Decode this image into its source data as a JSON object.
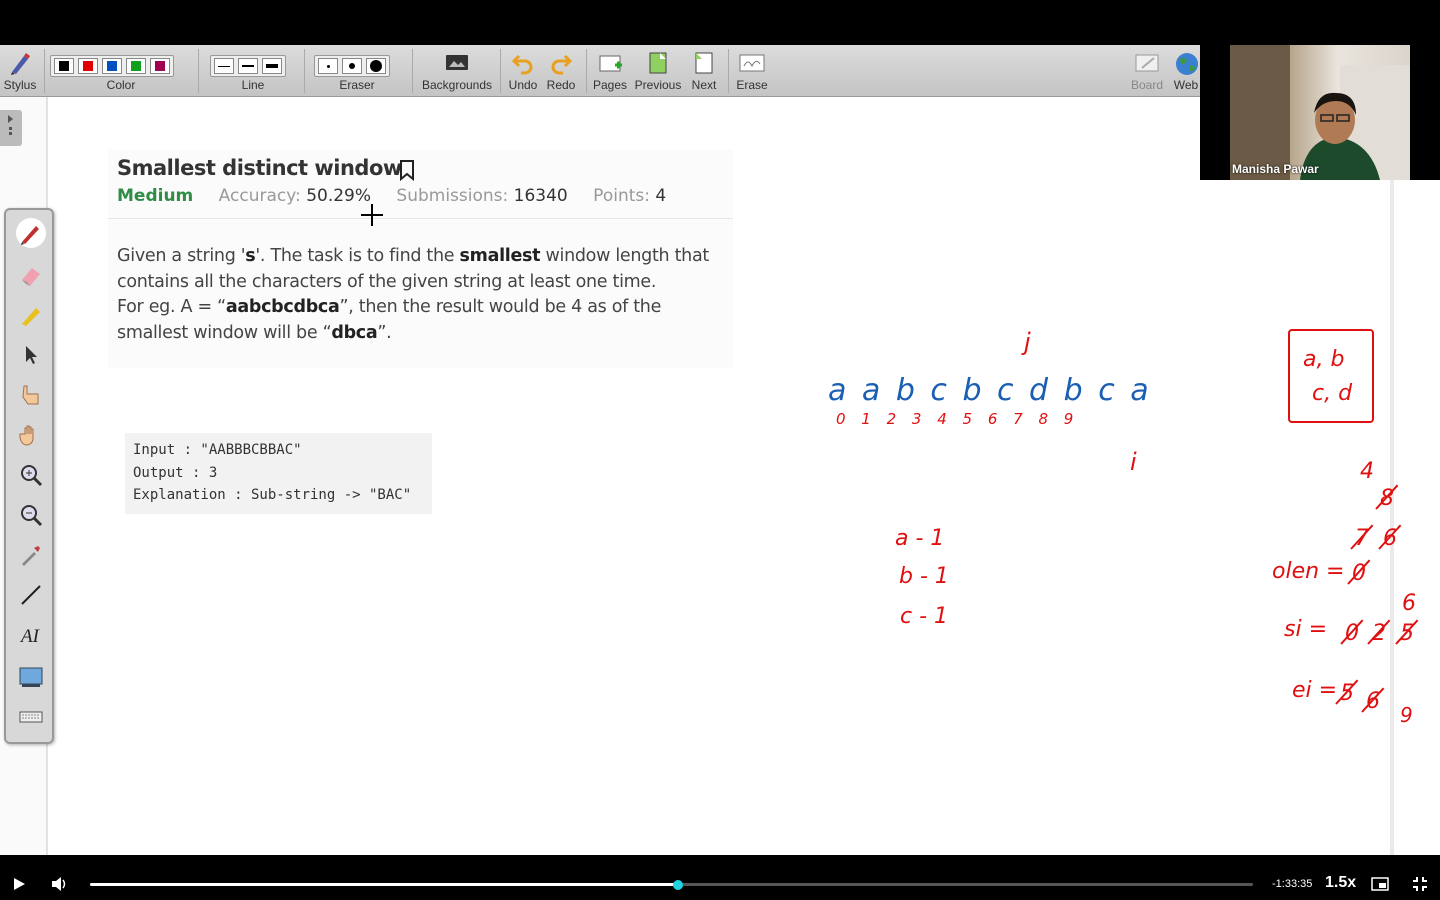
{
  "toolbar": {
    "stylus": "Stylus",
    "color": "Color",
    "line": "Line",
    "eraser": "Eraser",
    "backgrounds": "Backgrounds",
    "undo": "Undo",
    "redo": "Redo",
    "pages": "Pages",
    "previous": "Previous",
    "next": "Next",
    "erase": "Erase",
    "board": "Board",
    "web": "Web",
    "colors": [
      "#000000",
      "#e00000",
      "#0050c0",
      "#10a020",
      "#a00050"
    ]
  },
  "problem": {
    "title": "Smallest distinct window",
    "difficulty": "Medium",
    "accuracy_label": "Accuracy:",
    "accuracy_value": "50.29%",
    "submissions_label": "Submissions:",
    "submissions_value": "16340",
    "points_label": "Points:",
    "points_value": "4",
    "desc_1": "Given a string '",
    "desc_s": "s",
    "desc_2": "'. The task is to find the ",
    "desc_smallest": "smallest",
    "desc_3": " window length that contains all the characters of the given string at least one time.",
    "desc_4": "For eg. A = “",
    "desc_eg": "aabcbcdbca",
    "desc_5": "”, then the result would be 4 as of the smallest window will be “",
    "desc_ans": "dbca",
    "desc_6": "”."
  },
  "example": {
    "input": "Input : \"AABBBCBBAC\"",
    "output": "Output : 3",
    "explanation": "Explanation : Sub-string -> \"BAC\""
  },
  "handwriting": {
    "string": "a a b c b c d b c a",
    "indices": "0 1 2 3 4 5 6 7 8 9",
    "j": "j",
    "i": "i",
    "set_line1": "a, b",
    "set_line2": "c, d",
    "count_a": "a - 1",
    "count_b": "b - 1",
    "count_c": "c - 1",
    "olen": "olen =",
    "si": "si =",
    "ei": "ei =",
    "olen_values": "8 7 6 4",
    "si_values": "0 2 5 6",
    "ei_values": "5 6 9"
  },
  "webcam": {
    "name": "Manisha Pawar"
  },
  "player": {
    "time": "-1:33:35",
    "speed": "1.5x",
    "progress": 0.506
  }
}
